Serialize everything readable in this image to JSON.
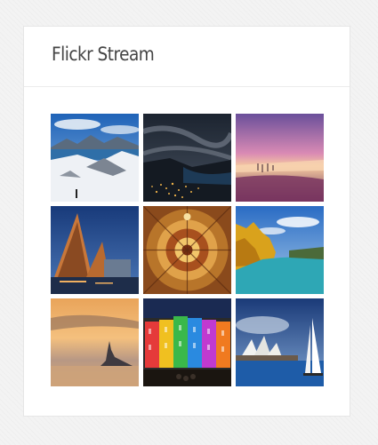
{
  "widget": {
    "title": "Flickr Stream"
  },
  "photos": [
    {
      "subject": "snowy-mountains-lake"
    },
    {
      "subject": "night-lakeside-town"
    },
    {
      "subject": "sunset-beach"
    },
    {
      "subject": "opera-house-night"
    },
    {
      "subject": "ornate-ceiling"
    },
    {
      "subject": "autumn-river"
    },
    {
      "subject": "island-castle-dusk"
    },
    {
      "subject": "light-show-building"
    },
    {
      "subject": "harbour-sailboat"
    }
  ],
  "colors": {
    "page_bg": "#f3f3f3",
    "card_bg": "#ffffff",
    "border": "#e6e6e6",
    "title": "#444444"
  }
}
